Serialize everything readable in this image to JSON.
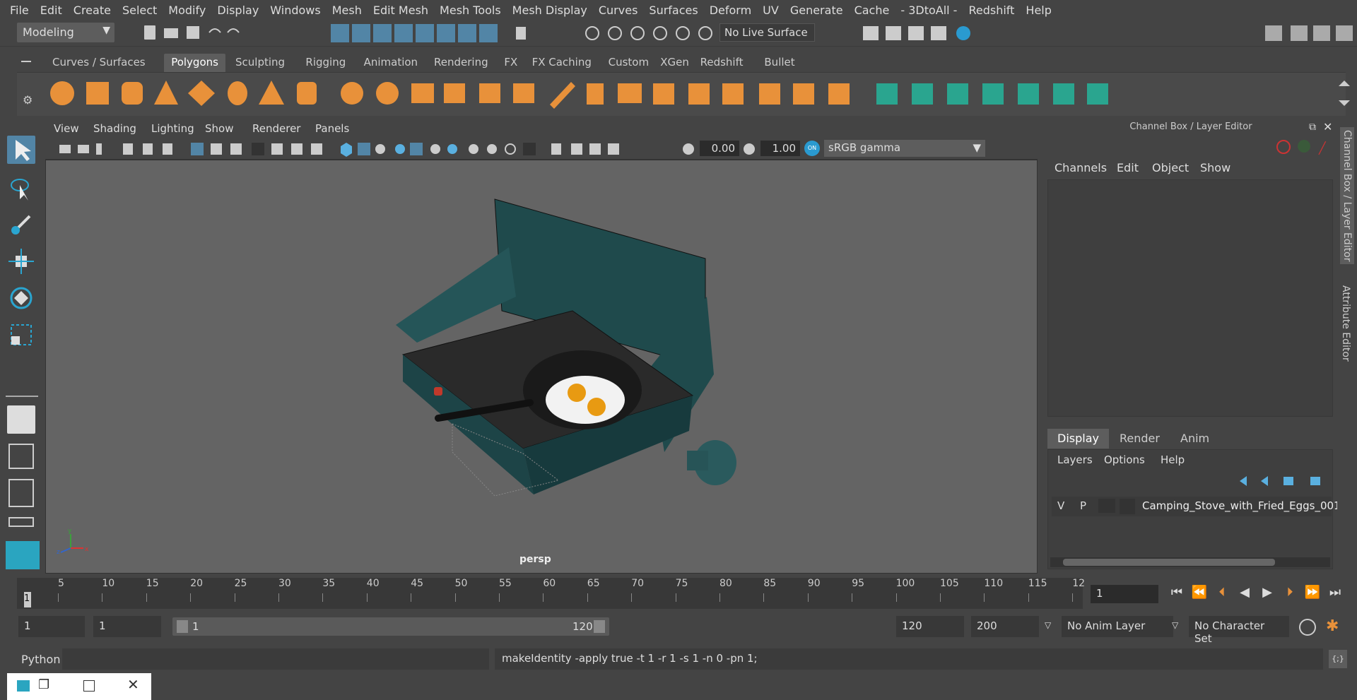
{
  "menubar": [
    "File",
    "Edit",
    "Create",
    "Select",
    "Modify",
    "Display",
    "Windows",
    "Mesh",
    "Edit Mesh",
    "Mesh Tools",
    "Mesh Display",
    "Curves",
    "Surfaces",
    "Deform",
    "UV",
    "Generate",
    "Cache",
    "- 3DtoAll -",
    "Redshift",
    "Help"
  ],
  "status": {
    "mode": "Modeling",
    "live_surface": "No Live Surface"
  },
  "shelf_tabs": [
    "Curves / Surfaces",
    "Polygons",
    "Sculpting",
    "Rigging",
    "Animation",
    "Rendering",
    "FX",
    "FX Caching",
    "Custom",
    "XGen",
    "Redshift",
    "Bullet"
  ],
  "shelf_active": "Polygons",
  "viewport": {
    "menus": [
      "View",
      "Shading",
      "Lighting",
      "Show",
      "Renderer",
      "Panels"
    ],
    "exposure": "0.00",
    "gamma_val": "1.00",
    "colorspace": "sRGB gamma",
    "camera": "persp"
  },
  "channel_box": {
    "title": "Channel Box / Layer Editor",
    "menus": [
      "Channels",
      "Edit",
      "Object",
      "Show"
    ]
  },
  "layer_editor": {
    "tabs": [
      "Display",
      "Render",
      "Anim"
    ],
    "menus": [
      "Layers",
      "Options",
      "Help"
    ],
    "layer": {
      "v": "V",
      "p": "P",
      "name": "Camping_Stove_with_Fried_Eggs_001"
    }
  },
  "side_tabs": [
    "Channel Box / Layer Editor",
    "Attribute Editor"
  ],
  "timeline": {
    "ticks": [
      "5",
      "10",
      "15",
      "20",
      "25",
      "30",
      "35",
      "40",
      "45",
      "50",
      "55",
      "60",
      "65",
      "70",
      "75",
      "80",
      "85",
      "90",
      "95",
      "100",
      "105",
      "110",
      "115",
      "12"
    ],
    "start_mark": "1",
    "current_frame": "1"
  },
  "range": {
    "start": "1",
    "start2": "1",
    "slider_start": "1",
    "slider_end": "120",
    "end": "120",
    "end2": "200",
    "anim_layer": "No Anim Layer",
    "char_set": "No Character Set"
  },
  "command": {
    "lang": "Python",
    "output": "makeIdentity -apply true -t 1 -r 1 -s 1 -n 0 -pn 1;"
  },
  "colors": {
    "accent": "#5285a6",
    "shelf_icon": "#e8913a",
    "mesh_teal": "#2a9d8f"
  }
}
